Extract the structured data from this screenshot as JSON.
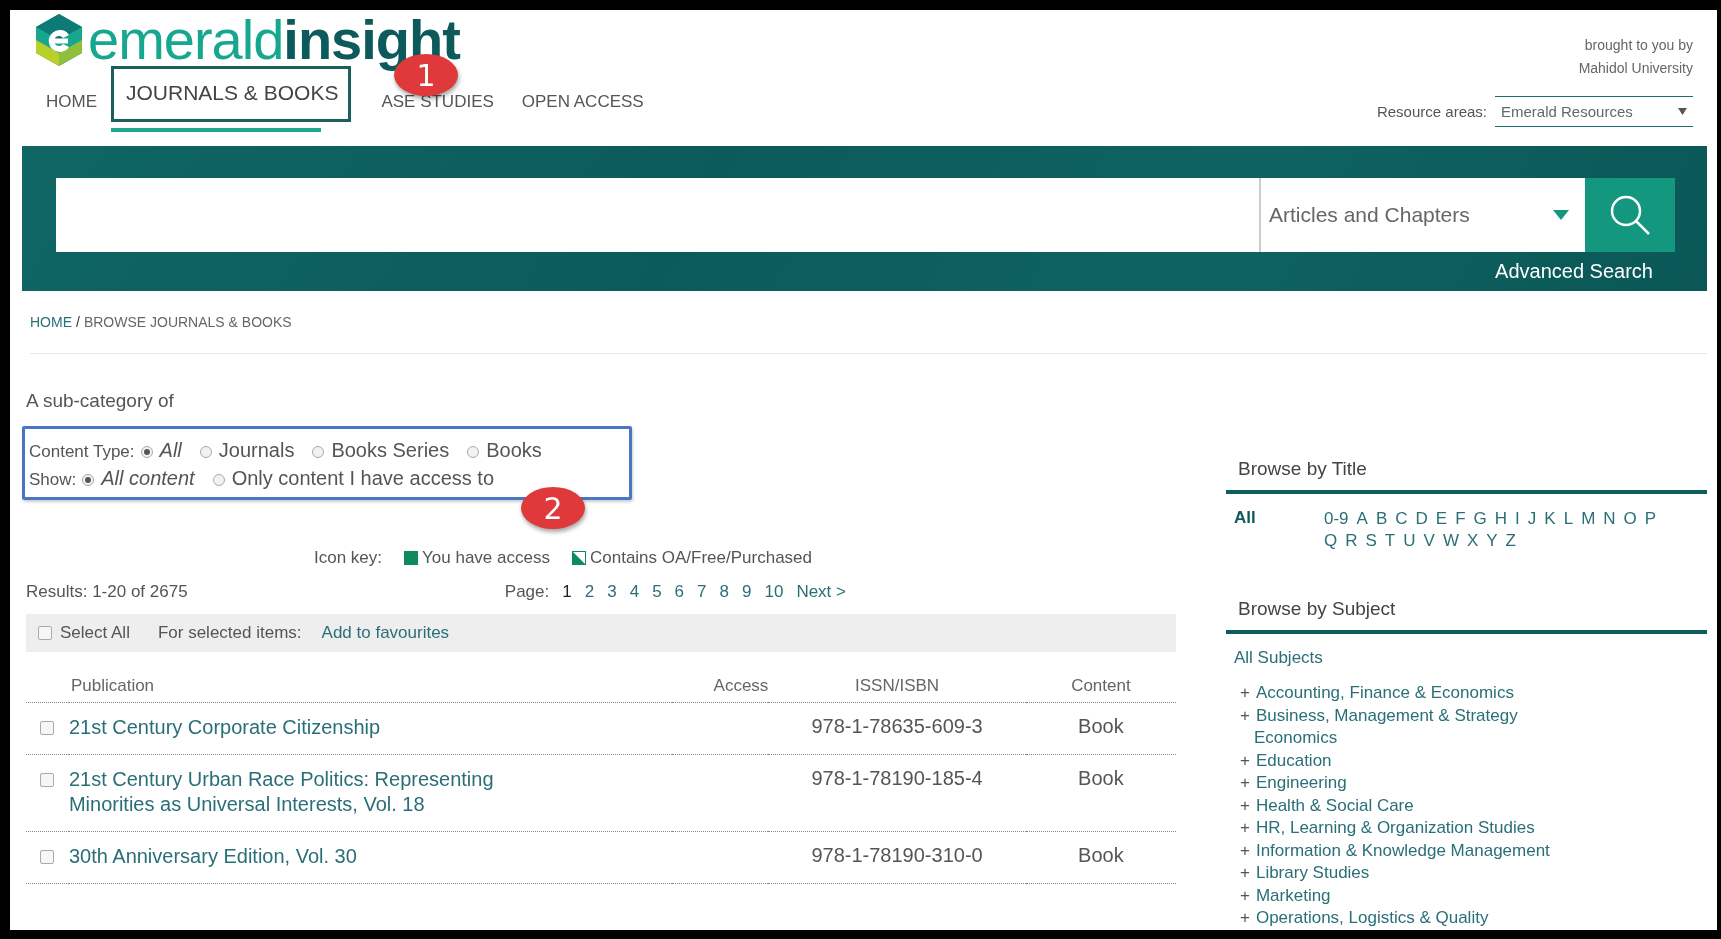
{
  "logo": {
    "light": "emerald",
    "bold": "insight"
  },
  "nav": [
    {
      "label": "HOME",
      "selected": false
    },
    {
      "label": "JOURNALS & BOOKS",
      "selected": true
    },
    {
      "label": "ASE STUDIES",
      "selected": false
    },
    {
      "label": "OPEN ACCESS",
      "selected": false
    }
  ],
  "brought_by": [
    "brought to you by",
    "Mahidol University"
  ],
  "resource_areas": {
    "label": "Resource areas:",
    "value": "Emerald Resources"
  },
  "search": {
    "scope": "Articles and Chapters",
    "advanced_link": "Advanced Search"
  },
  "breadcrumb": {
    "home": "HOME",
    "separator": "/",
    "current": "BROWSE JOURNALS & BOOKS"
  },
  "subcategory": "A sub-category of",
  "content_type": {
    "label": "Content Type:",
    "options": [
      {
        "label": "All",
        "selected": true
      },
      {
        "label": "Journals",
        "selected": false
      },
      {
        "label": "Books Series",
        "selected": false
      },
      {
        "label": "Books",
        "selected": false
      }
    ]
  },
  "show": {
    "label": "Show:",
    "options": [
      {
        "label": "All content",
        "selected": true
      },
      {
        "label": "Only content I have access to",
        "selected": false
      }
    ]
  },
  "icon_key": {
    "label": "Icon key:",
    "items": [
      {
        "kind": "full",
        "label": "You have access"
      },
      {
        "kind": "partial",
        "label": "Contains OA/Free/Purchased"
      }
    ]
  },
  "results": "Results: 1-20 of 2675",
  "pagination": {
    "label": "Page:",
    "pages": [
      {
        "label": "1",
        "selected": true
      },
      {
        "label": "2",
        "selected": false
      },
      {
        "label": "3",
        "selected": false
      },
      {
        "label": "4",
        "selected": false
      },
      {
        "label": "5",
        "selected": false
      },
      {
        "label": "6",
        "selected": false
      },
      {
        "label": "7",
        "selected": false
      },
      {
        "label": "8",
        "selected": false
      },
      {
        "label": "9",
        "selected": false
      },
      {
        "label": "10",
        "selected": false
      }
    ],
    "next": "Next >"
  },
  "toolbar": {
    "select_all": {
      "label": "Select All",
      "checked": false
    },
    "for_selected": "For selected items:",
    "action": "Add to favourites"
  },
  "table": {
    "columns": [
      "Publication",
      "Access",
      "ISSN/ISBN",
      "Content"
    ],
    "rows": [
      {
        "checked": false,
        "publication": "21st Century Corporate Citizenship",
        "isbn": "978-1-78635-609-3",
        "content": "Book"
      },
      {
        "checked": false,
        "publication": "21st Century Urban Race Politics: Representing Minorities as Universal Interests, Vol. 18",
        "isbn": "978-1-78190-185-4",
        "content": "Book"
      },
      {
        "checked": false,
        "publication": "30th Anniversary Edition, Vol. 30",
        "isbn": "978-1-78190-310-0",
        "content": "Book"
      }
    ]
  },
  "sidebar": {
    "browse_title": {
      "heading": "Browse by Title",
      "all": "All",
      "letters": [
        "0-9",
        "A",
        "B",
        "C",
        "D",
        "E",
        "F",
        "G",
        "H",
        "I",
        "J",
        "K",
        "L",
        "M",
        "N",
        "O",
        "P",
        "Q",
        "R",
        "S",
        "T",
        "U",
        "V",
        "W",
        "X",
        "Y",
        "Z"
      ]
    },
    "browse_subject": {
      "heading": "Browse by Subject",
      "all": "All Subjects",
      "subjects": [
        {
          "expander": "+",
          "label": "Accounting, Finance & Economics"
        },
        {
          "expander": "+",
          "label": "Business, Management & Strategy"
        },
        {
          "label": "Economics"
        },
        {
          "expander": "+",
          "label": "Education"
        },
        {
          "expander": "+",
          "label": "Engineering"
        },
        {
          "expander": "+",
          "label": "Health & Social Care"
        },
        {
          "expander": "+",
          "label": "HR, Learning & Organization Studies"
        },
        {
          "expander": "+",
          "label": "Information & Knowledge Management"
        },
        {
          "expander": "+",
          "label": "Library Studies"
        },
        {
          "expander": "+",
          "label": "Marketing"
        },
        {
          "expander": "+",
          "label": "Operations, Logistics & Quality"
        }
      ]
    }
  },
  "annotations": [
    {
      "kind": "callout",
      "label": "1"
    },
    {
      "kind": "callout",
      "label": "2"
    }
  ]
}
